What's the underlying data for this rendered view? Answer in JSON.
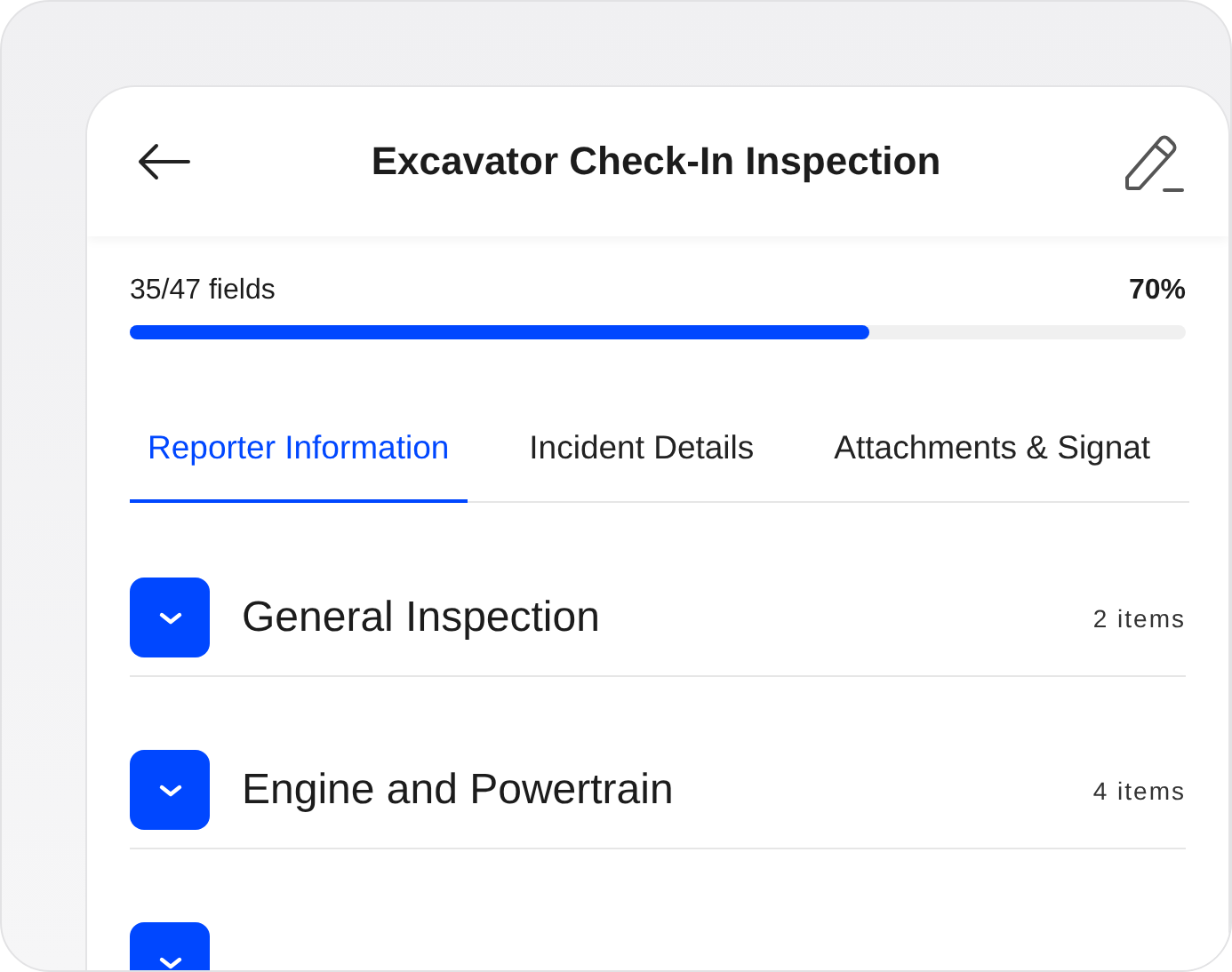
{
  "header": {
    "title": "Excavator Check-In Inspection"
  },
  "progress": {
    "fields": "35/47 fields",
    "percent": "70%",
    "level": 0.7
  },
  "tabs": [
    {
      "label": "Reporter Information",
      "selected": true
    },
    {
      "label": "Incident Details",
      "selected": false
    },
    {
      "label": "Attachments & Signat",
      "selected": false
    }
  ],
  "sections": [
    {
      "title": "General Inspection",
      "count": "2 items",
      "expanded": false
    },
    {
      "title": "Engine and Powertrain",
      "count": "4 items",
      "expanded": false
    },
    {
      "expanded": false
    }
  ]
}
